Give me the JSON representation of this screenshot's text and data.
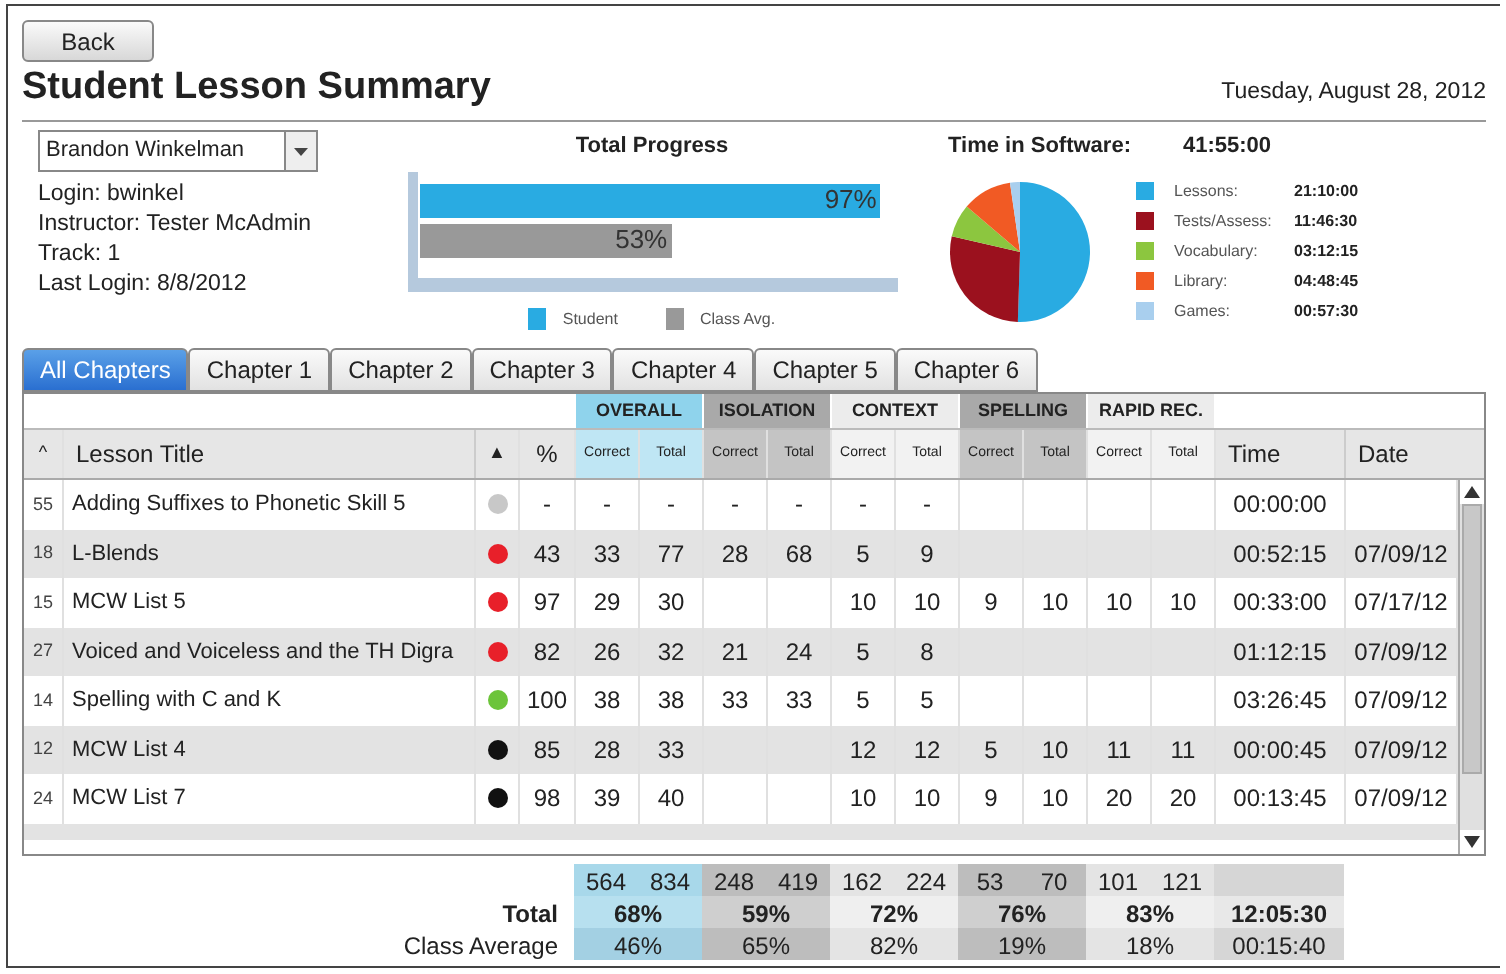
{
  "back_button": "Back",
  "title": "Student Lesson Summary",
  "date": "Tuesday, August 28, 2012",
  "student": {
    "selected_name": "Brandon Winkelman",
    "login": "Login: bwinkel",
    "instructor": "Instructor: Tester McAdmin",
    "track": "Track: 1",
    "last_login": "Last Login: 8/8/2012"
  },
  "progress": {
    "title": "Total Progress",
    "bars": [
      {
        "label": "Student",
        "value": "97%",
        "level": 0.97,
        "color": "#29abe2"
      },
      {
        "label": "Class Avg.",
        "value": "53%",
        "level": 0.53,
        "color": "#999999"
      }
    ]
  },
  "time_in_software": {
    "label": "Time in Software:",
    "total": "41:55:00",
    "legend": [
      {
        "label": "Lessons:",
        "time": "21:10:00",
        "color": "#29abe2"
      },
      {
        "label": "Tests/Assess:",
        "time": "11:46:30",
        "color": "#9b111e"
      },
      {
        "label": "Vocabulary:",
        "time": "03:12:15",
        "color": "#8cc63f"
      },
      {
        "label": "Library:",
        "time": "04:48:45",
        "color": "#f15a24"
      },
      {
        "label": "Games:",
        "time": "00:57:30",
        "color": "#a9cfee"
      }
    ]
  },
  "tabs": [
    {
      "label": "All Chapters",
      "selected": true
    },
    {
      "label": "Chapter 1",
      "selected": false
    },
    {
      "label": "Chapter 2",
      "selected": false
    },
    {
      "label": "Chapter 3",
      "selected": false
    },
    {
      "label": "Chapter 4",
      "selected": false
    },
    {
      "label": "Chapter 5",
      "selected": false
    },
    {
      "label": "Chapter 6",
      "selected": false
    }
  ],
  "table": {
    "groups": [
      {
        "label": "OVERALL",
        "kind": "blue",
        "columns": [
          "Correct",
          "Total"
        ]
      },
      {
        "label": "ISOLATION",
        "kind": "dark",
        "columns": [
          "Correct",
          "Total"
        ]
      },
      {
        "label": "CONTEXT",
        "kind": "light",
        "columns": [
          "Correct",
          "Total"
        ]
      },
      {
        "label": "SPELLING",
        "kind": "dark",
        "columns": [
          "Correct",
          "Total"
        ]
      },
      {
        "label": "RAPID REC.",
        "kind": "light",
        "columns": [
          "Correct",
          "Total"
        ]
      }
    ],
    "columns": {
      "number": "^",
      "title": "Lesson Title",
      "status": "▲",
      "percent": "%",
      "time": "Time",
      "date": "Date"
    },
    "rows": [
      {
        "number": "55",
        "title": "Adding Suffixes to Phonetic Skill 5",
        "color": "#c8c8c8",
        "percent": "-",
        "cells": [
          "-",
          "-",
          "-",
          "-",
          "-",
          "-",
          null,
          null,
          null,
          null
        ],
        "time": "00:00:00",
        "date": null
      },
      {
        "number": "18",
        "title": "L-Blends",
        "color": "#e8202a",
        "percent": "43",
        "cells": [
          "33",
          "77",
          "28",
          "68",
          "5",
          "9",
          null,
          null,
          null,
          null
        ],
        "time": "00:52:15",
        "date": "07/09/12"
      },
      {
        "number": "15",
        "title": "MCW List 5",
        "color": "#e8202a",
        "percent": "97",
        "cells": [
          "29",
          "30",
          null,
          null,
          "10",
          "10",
          "9",
          "10",
          "10",
          "10"
        ],
        "time": "00:33:00",
        "date": "07/17/12"
      },
      {
        "number": "27",
        "title": "Voiced and Voiceless and the TH Digra",
        "color": "#e8202a",
        "percent": "82",
        "cells": [
          "26",
          "32",
          "21",
          "24",
          "5",
          "8",
          null,
          null,
          null,
          null
        ],
        "time": "01:12:15",
        "date": "07/09/12"
      },
      {
        "number": "14",
        "title": "Spelling with C and K",
        "color": "#6cc43a",
        "percent": "100",
        "cells": [
          "38",
          "38",
          "33",
          "33",
          "5",
          "5",
          null,
          null,
          null,
          null
        ],
        "time": "03:26:45",
        "date": "07/09/12"
      },
      {
        "number": "12",
        "title": "MCW List 4",
        "color": "#111111",
        "percent": "85",
        "cells": [
          "28",
          "33",
          null,
          null,
          "12",
          "12",
          "5",
          "10",
          "11",
          "11"
        ],
        "time": "00:00:45",
        "date": "07/09/12"
      },
      {
        "number": "24",
        "title": "MCW List 7",
        "color": "#111111",
        "percent": "98",
        "cells": [
          "39",
          "40",
          null,
          null,
          "10",
          "10",
          "9",
          "10",
          "20",
          "20"
        ],
        "time": "00:13:45",
        "date": "07/09/12"
      }
    ],
    "counts": [
      "564",
      "834",
      "248",
      "419",
      "162",
      "224",
      "53",
      "70",
      "101",
      "121"
    ],
    "total": {
      "label": "Total",
      "percents": [
        "68%",
        "59%",
        "72%",
        "76%",
        "83%"
      ],
      "time": "12:05:30"
    },
    "class_average": {
      "label": "Class Average",
      "percents": [
        "46%",
        "65%",
        "82%",
        "19%",
        "18%"
      ],
      "time": "00:15:40"
    }
  }
}
